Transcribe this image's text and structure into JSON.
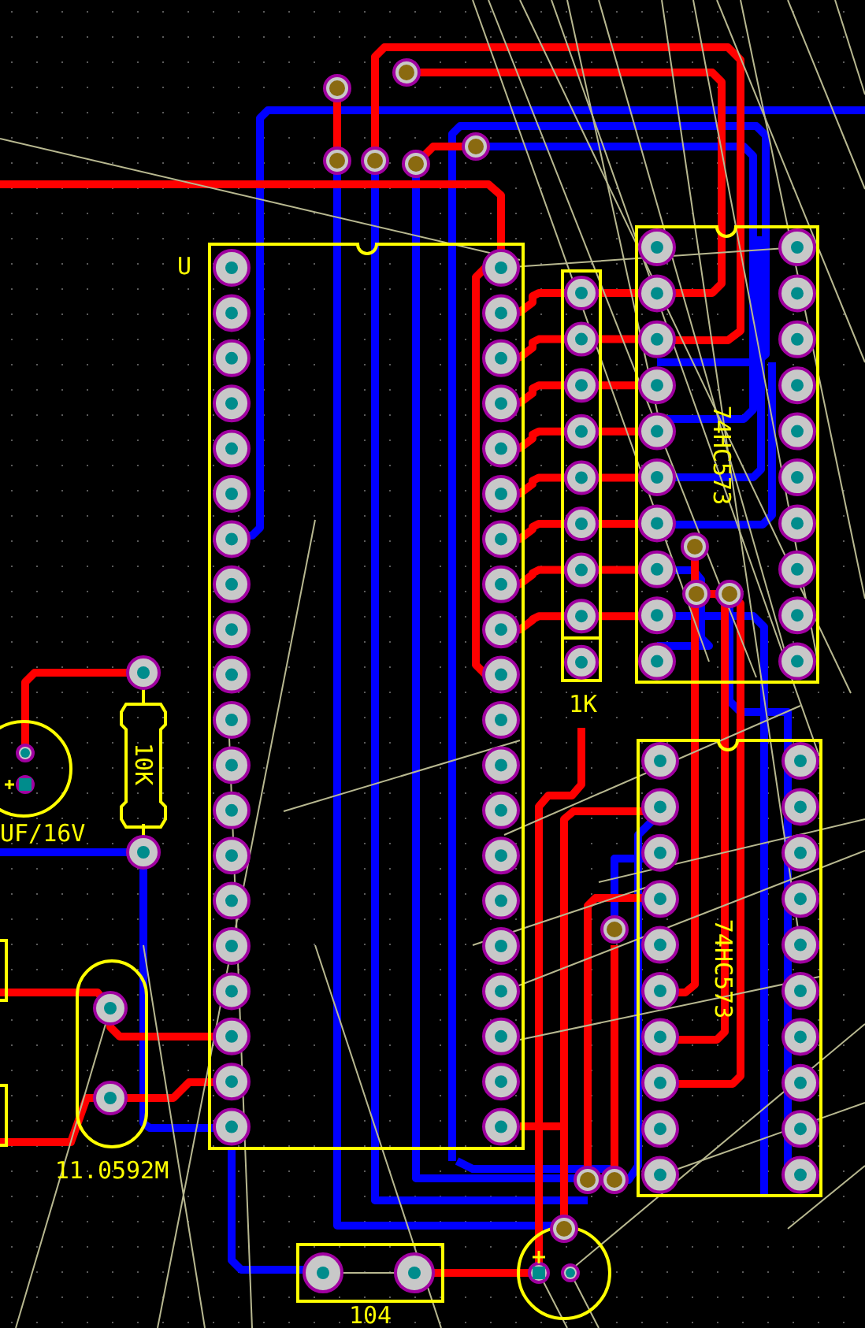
{
  "board": {
    "components": [
      {
        "kind": "dip40",
        "label": "U"
      },
      {
        "kind": "sip9",
        "label": "1K"
      },
      {
        "kind": "dip20",
        "label": "74HC573"
      },
      {
        "kind": "dip20",
        "label": "74HC573"
      },
      {
        "kind": "axial_resistor",
        "label": "10K"
      },
      {
        "kind": "radial_cap",
        "label": "UF/16V"
      },
      {
        "kind": "crystal",
        "label": "11.0592M"
      },
      {
        "kind": "ceramic_cap",
        "label": "104"
      },
      {
        "kind": "radial_cap_small"
      },
      {
        "kind": "edge_part"
      },
      {
        "kind": "edge_part"
      }
    ]
  }
}
